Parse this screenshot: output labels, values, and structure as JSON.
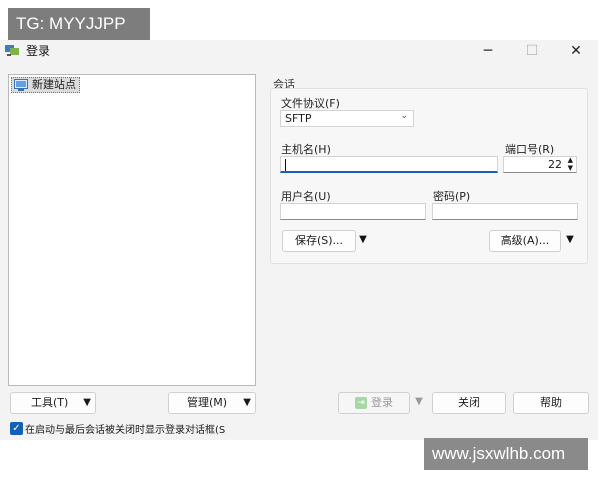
{
  "watermarks": {
    "top": "TG: MYYJJPP",
    "bottom": "www.jsxwlhb.com"
  },
  "window": {
    "title": "登录",
    "controls": {
      "minimize": "─",
      "maximize": "☐",
      "close": "✕"
    }
  },
  "site_tree": {
    "items": [
      {
        "label": "新建站点",
        "icon": "new-site-icon"
      }
    ]
  },
  "left_buttons": {
    "tools": "工具(T)",
    "manage": "管理(M)"
  },
  "session": {
    "group_label": "会话",
    "protocol_label": "文件协议(F)",
    "protocol_value": "SFTP",
    "host_label": "主机名(H)",
    "host_value": "",
    "port_label": "端口号(R)",
    "port_value": "22",
    "user_label": "用户名(U)",
    "user_value": "",
    "password_label": "密码(P)",
    "password_value": "",
    "save_button": "保存(S)...",
    "advanced_button": "高级(A)..."
  },
  "bottom_buttons": {
    "login": "登录",
    "close": "关闭",
    "help": "帮助"
  },
  "checkbox": {
    "checked": true,
    "label": "在启动与最后会话被关闭时显示登录对话框(S"
  },
  "colors": {
    "accent": "#1460b8",
    "window_bg": "#f3f3f3"
  }
}
